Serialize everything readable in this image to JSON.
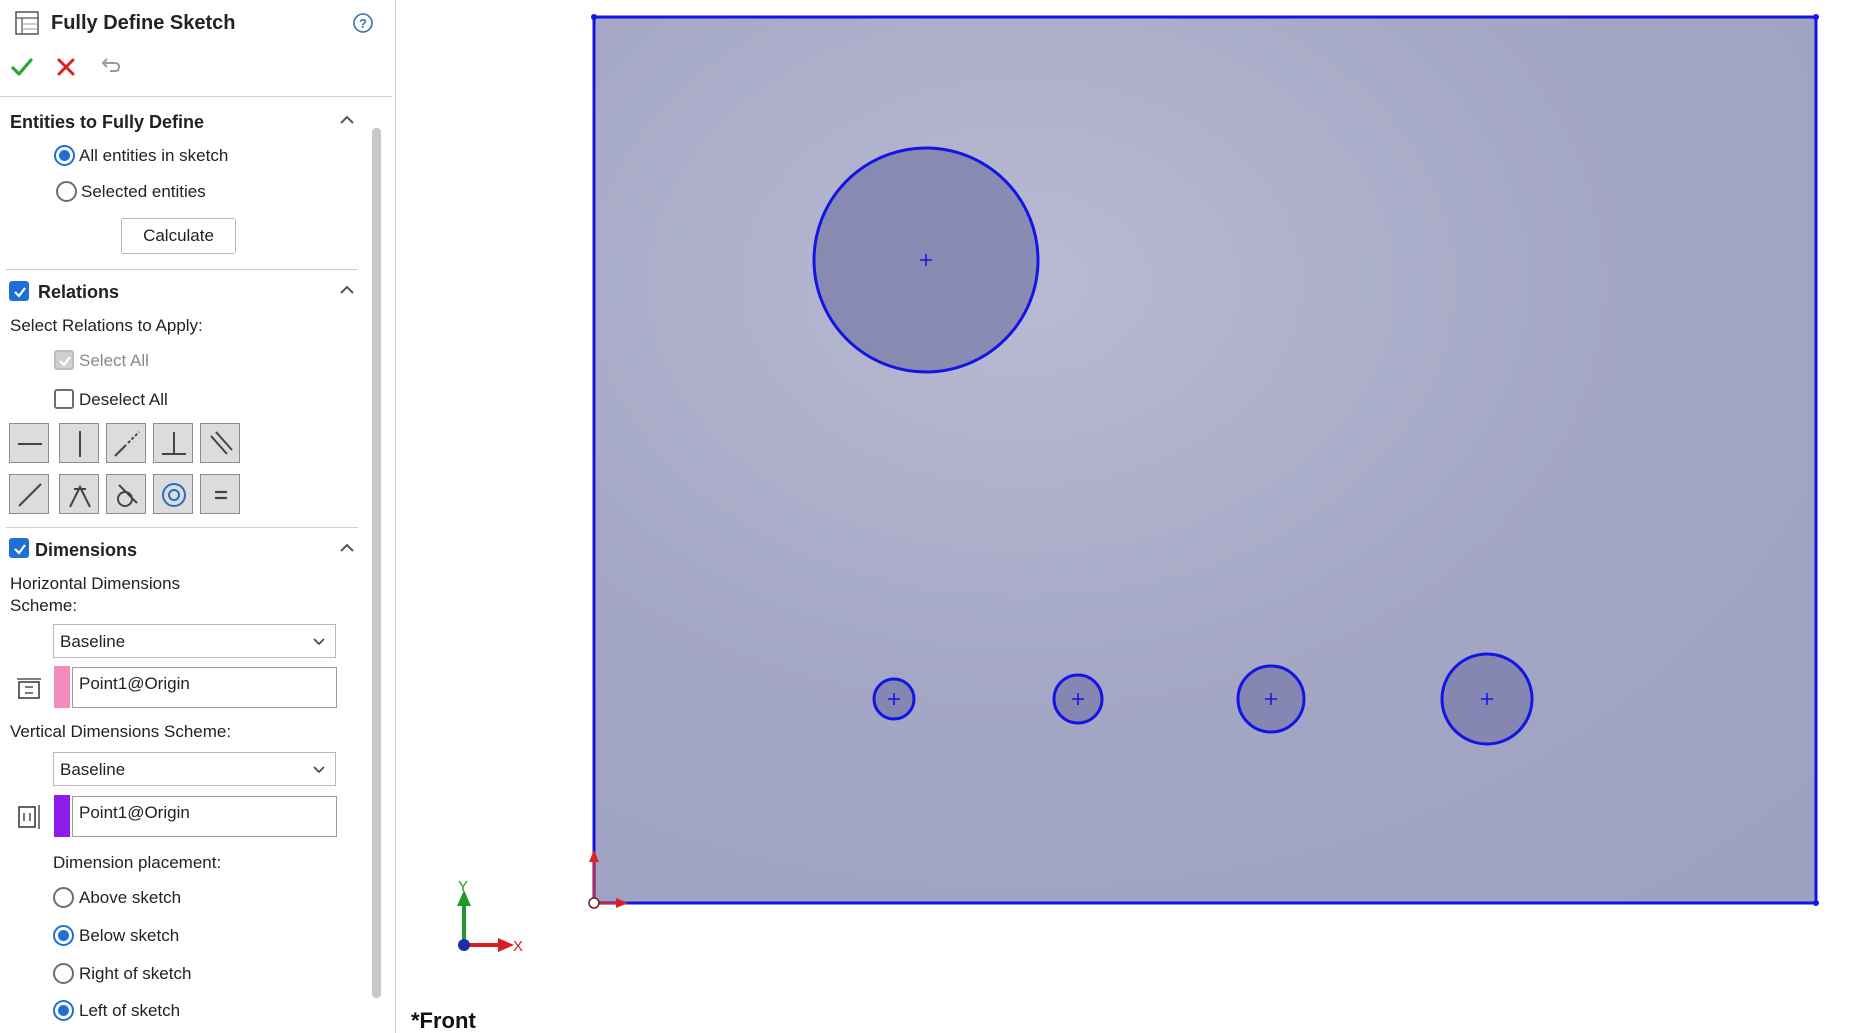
{
  "header": {
    "title": "Fully Define Sketch",
    "help_icon": "help-circle-icon",
    "ok_icon": "green-check-icon",
    "cancel_icon": "red-x-icon",
    "undo_icon": "undo-icon"
  },
  "entities": {
    "title": "Entities to Fully Define",
    "options": [
      {
        "label": "All entities in sketch",
        "selected": true
      },
      {
        "label": "Selected entities",
        "selected": false
      }
    ],
    "calculate_label": "Calculate"
  },
  "relations": {
    "title": "Relations",
    "checked": true,
    "select_label": "Select Relations to Apply:",
    "select_all_label": "Select All",
    "select_all_checked": true,
    "deselect_all_label": "Deselect All",
    "deselect_all_checked": false,
    "buttons_row1": [
      "horizontal-relation-icon",
      "vertical-relation-icon",
      "collinear-relation-icon",
      "perpendicular-relation-icon",
      "parallel-relation-icon"
    ],
    "buttons_row2": [
      "midpoint-relation-icon",
      "coincident-relation-icon",
      "tangent-relation-icon",
      "concentric-relation-icon",
      "equal-relation-icon"
    ]
  },
  "dimensions": {
    "title": "Dimensions",
    "checked": true,
    "horizontal_label_line1": "Horizontal Dimensions",
    "horizontal_label_line2": "Scheme:",
    "horizontal_scheme": "Baseline",
    "horizontal_datum": "Point1@Origin",
    "horizontal_color": "#f28bbf",
    "vertical_label": "Vertical Dimensions Scheme:",
    "vertical_scheme": "Baseline",
    "vertical_datum": "Point1@Origin",
    "vertical_color": "#8a1ee6",
    "placement_label": "Dimension placement:",
    "placement_options": [
      {
        "label": "Above sketch",
        "selected": false
      },
      {
        "label": "Below sketch",
        "selected": true
      },
      {
        "label": "Right of sketch",
        "selected": false
      },
      {
        "label": "Left of sketch",
        "selected": true
      }
    ]
  },
  "viewport": {
    "view_name": "*Front",
    "axis_x_label": "X",
    "axis_y_label": "Y",
    "sketch_color": "#1414e6",
    "face_color": "#a6a8c6"
  }
}
